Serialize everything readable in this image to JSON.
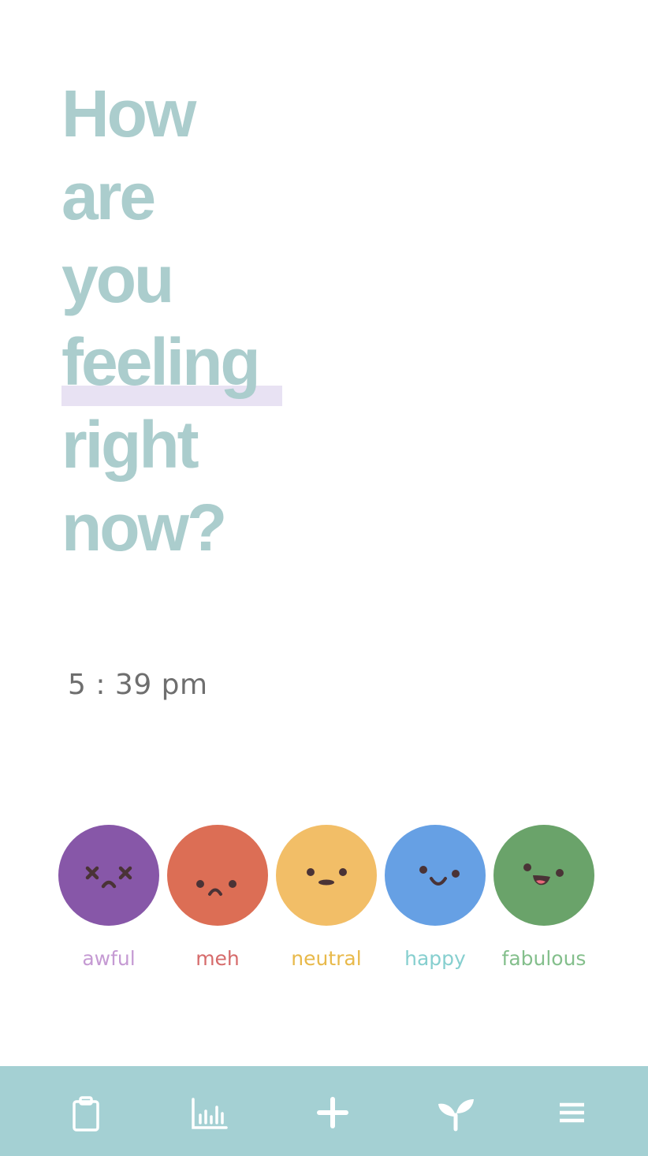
{
  "question": {
    "lines": [
      "How",
      "are",
      "you",
      "feeling",
      "right",
      "now?"
    ],
    "highlighted_word": "feeling"
  },
  "time": "5 : 39 pm",
  "moods": [
    {
      "label": "awful",
      "face_color": "#8757a8",
      "label_color": "#c59ad3",
      "icon": "dizzy-face-icon"
    },
    {
      "label": "meh",
      "face_color": "#dc6e55",
      "label_color": "#d66b6b",
      "icon": "frown-face-icon"
    },
    {
      "label": "neutral",
      "face_color": "#f2be67",
      "label_color": "#e8b94a",
      "icon": "neutral-face-icon"
    },
    {
      "label": "happy",
      "face_color": "#66a0e4",
      "label_color": "#86cfcf",
      "icon": "smile-face-icon"
    },
    {
      "label": "fabulous",
      "face_color": "#6aa36a",
      "label_color": "#84bf8c",
      "icon": "grin-face-icon"
    }
  ],
  "navbar": {
    "background": "#a4d0d3",
    "items": [
      {
        "icon": "clipboard-icon"
      },
      {
        "icon": "bar-chart-icon"
      },
      {
        "icon": "plus-icon"
      },
      {
        "icon": "sprout-icon"
      },
      {
        "icon": "menu-icon"
      }
    ]
  },
  "colors": {
    "heading": "#abcdcd",
    "highlight": "#e8e2f3",
    "time_text": "#6e6e6e",
    "eye": "#4a3336"
  }
}
